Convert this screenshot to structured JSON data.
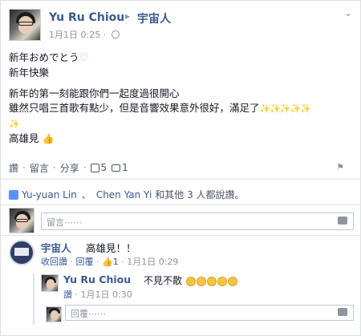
{
  "post": {
    "author": "Yu Ru Chiou",
    "arrow": "▸",
    "target": "宇宙人",
    "time": "1月1日 0:25",
    "lines": [
      "新年おめでとう",
      "新年快樂",
      "新年的第一刻能跟你們一起度過很開心",
      "雖然只唱三首歌有點少，但是音響效果意外很好，滿足了",
      "高雄見"
    ],
    "sparkles": "✨✨✨✨✨",
    "sparkle_single": "✨"
  },
  "actions": {
    "like": "讚",
    "comment": "留言",
    "share": "分享",
    "like_count": "5",
    "comment_count": "1"
  },
  "likes_bar": {
    "name1": "Yu-yuan Lin",
    "sep": "、",
    "name2": "Chen Yan Yi",
    "rest": "和其他 3 人都說讚。"
  },
  "comment_input": {
    "placeholder": "留言⋯⋯"
  },
  "comment1": {
    "author": "宇宙人",
    "text": "高雄見！！",
    "unlike": "收回讚",
    "reply": "回覆",
    "likes": "1",
    "time": "1月1日 0:29"
  },
  "reply1": {
    "author": "Yu Ru Chiou",
    "text": "不見不散",
    "like": "讚",
    "time": "1月1日 0:30"
  },
  "reply_input": {
    "placeholder": "回覆⋯⋯"
  }
}
